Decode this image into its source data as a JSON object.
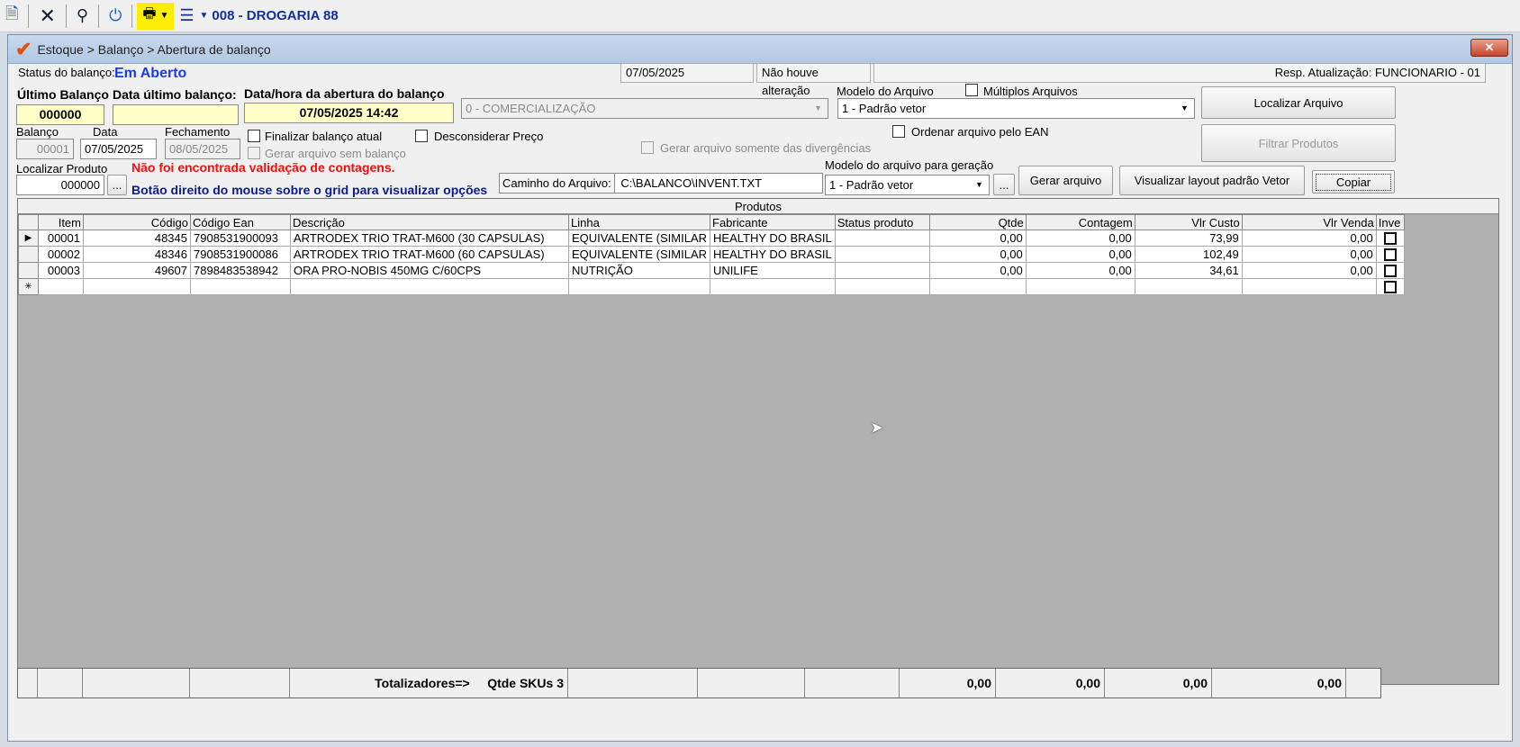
{
  "toolbar": {
    "company": "008 - DROGARIA 88"
  },
  "window": {
    "title": "Estoque > Balanço > Abertura de balanço",
    "close_label": "✕"
  },
  "status": {
    "label": "Status do balanço:",
    "value": "Em Aberto",
    "date": "07/05/2025",
    "change": "Não houve alteração",
    "resp": "Resp. Atualização: FUNCIONARIO - 01"
  },
  "header": {
    "ultimo_balanco_label": "Último Balanço",
    "ultimo_balanco_value": "000000",
    "data_ultimo_label": "Data último balanço:",
    "data_ultimo_value": "",
    "abertura_label": "Data/hora da abertura do balanço",
    "abertura_value": "07/05/2025 14:42",
    "operacao_value": "0 - COMERCIALIZAÇÃO",
    "modelo_arquivo_label": "Modelo do Arquivo",
    "modelo_arquivo_value": "1 - Padrão vetor",
    "multiplos_label": "Múltiplos Arquivos",
    "localizar_arquivo_label": "Localizar Arquivo",
    "filtrar_produtos_label": "Filtrar Produtos",
    "balanco_label": "Balanço",
    "balanco_value": "00001",
    "data_label": "Data",
    "data_value": "07/05/2025",
    "fechamento_label": "Fechamento",
    "fechamento_value": "08/05/2025",
    "finalizar_label": "Finalizar balanço atual",
    "gerar_sem_label": "Gerar arquivo sem balanço",
    "desconsiderar_label": "Desconsiderar Preço",
    "divergencias_label": "Gerar arquivo somente das divergências",
    "ordenar_label": "Ordenar arquivo pelo EAN",
    "localizar_produto_label": "Localizar Produto",
    "localizar_produto_value": "000000",
    "ellipsis": "...",
    "validation_msg": "Não foi encontrada validação de contagens.",
    "hint_msg": "Botão direito do mouse sobre o grid para visualizar opções",
    "caminho_label": "Caminho do Arquivo:",
    "caminho_value": "C:\\BALANCO\\INVENT.TXT",
    "modelo_geracao_label": "Modelo do arquivo para geração",
    "modelo_geracao_value": "1 - Padrão vetor",
    "gerar_arquivo_label": "Gerar arquivo",
    "visualizar_label": "Visualizar layout padrão Vetor",
    "copiar_label": "Copiar"
  },
  "grid": {
    "title": "Produtos",
    "columns": [
      "Item",
      "Código",
      "Código Ean",
      "Descrição",
      "Linha",
      "Fabricante",
      "Status produto",
      "Qtde",
      "Contagem",
      "Vlr Custo",
      "Vlr Venda",
      "Inve"
    ],
    "rows": [
      {
        "item": "00001",
        "codigo": "48345",
        "ean": "7908531900093",
        "descricao": "ARTRODEX TRIO TRAT-M600 (30 CAPSULAS)",
        "linha": "EQUIVALENTE (SIMILAR",
        "fabricante": "HEALTHY DO BRASIL",
        "status": "",
        "qtde": "0,00",
        "contagem": "0,00",
        "custo": "73,99",
        "venda": "0,00"
      },
      {
        "item": "00002",
        "codigo": "48346",
        "ean": "7908531900086",
        "descricao": "ARTRODEX TRIO TRAT-M600 (60 CAPSULAS)",
        "linha": "EQUIVALENTE (SIMILAR",
        "fabricante": "HEALTHY DO BRASIL",
        "status": "",
        "qtde": "0,00",
        "contagem": "0,00",
        "custo": "102,49",
        "venda": "0,00"
      },
      {
        "item": "00003",
        "codigo": "49607",
        "ean": "7898483538942",
        "descricao": "ORA PRO-NOBIS 450MG C/60CPS",
        "linha": "NUTRIÇÃO",
        "fabricante": "UNILIFE",
        "status": "",
        "qtde": "0,00",
        "contagem": "0,00",
        "custo": "34,61",
        "venda": "0,00"
      }
    ]
  },
  "totals": {
    "label": "Totalizadores=>",
    "skus": "Qtde SKUs 3",
    "qtde": "0,00",
    "contagem": "0,00",
    "custo": "0,00",
    "venda": "0,00"
  },
  "icons": {
    "row_pointer": "▶",
    "new_row": "✳"
  }
}
